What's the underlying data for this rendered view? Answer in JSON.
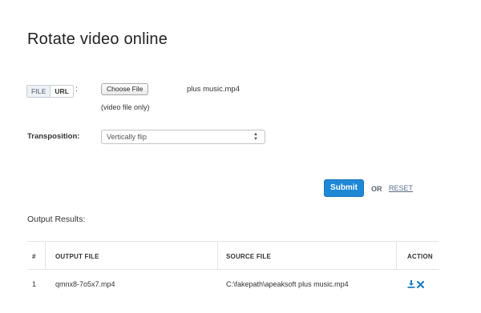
{
  "page": {
    "title": "Rotate video online"
  },
  "source_toggle": {
    "file_label": "FILE",
    "url_label": "URL",
    "separator": ":"
  },
  "file_input": {
    "button_label": "Choose File",
    "file_name": "plus music.mp4",
    "note": "(video file only)"
  },
  "transposition": {
    "label": "Transposition:",
    "selected": "Vertically flip"
  },
  "actions": {
    "submit_label": "Submit",
    "or_label": "OR",
    "reset_label": "RESET",
    "submit_color": "#1e88d7"
  },
  "results": {
    "heading": "Output Results:",
    "columns": [
      "#",
      "OUTPUT FILE",
      "SOURCE FILE",
      "ACTION"
    ],
    "rows": [
      {
        "num": "1",
        "output_file": "qmnx8-7o5x7.mp4",
        "source_file": "C:\\fakepath\\apeaksoft plus music.mp4",
        "actions": [
          "download-icon",
          "delete-icon"
        ]
      }
    ]
  }
}
